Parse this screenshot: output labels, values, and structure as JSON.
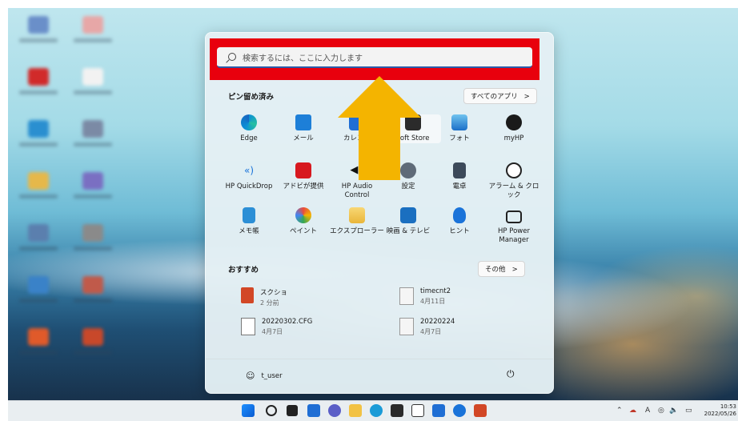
{
  "search": {
    "placeholder": "検索するには、ここに入力します"
  },
  "pinned": {
    "title": "ピン留め済み",
    "all_apps_label": "すべてのアプリ",
    "apps": [
      {
        "label": "Edge",
        "icon": "edge-icon"
      },
      {
        "label": "メール",
        "icon": "mail-icon"
      },
      {
        "label": "カレンダ",
        "icon": "calendar-icon"
      },
      {
        "label": "soft Store",
        "icon": "store-icon"
      },
      {
        "label": "フォト",
        "icon": "photos-icon"
      },
      {
        "label": "myHP",
        "icon": "myhp-icon"
      },
      {
        "label": "HP QuickDrop",
        "icon": "quickdrop-icon"
      },
      {
        "label": "アドビが提供",
        "icon": "adobe-icon"
      },
      {
        "label": "HP Audio Control",
        "icon": "audio-icon"
      },
      {
        "label": "設定",
        "icon": "gear-icon"
      },
      {
        "label": "電卓",
        "icon": "calculator-icon"
      },
      {
        "label": "アラーム & クロック",
        "icon": "alarm-clock-icon"
      },
      {
        "label": "メモ帳",
        "icon": "notepad-icon"
      },
      {
        "label": "ペイント",
        "icon": "paint-icon"
      },
      {
        "label": "エクスプローラー",
        "icon": "folder-icon"
      },
      {
        "label": "映画 & テレビ",
        "icon": "movies-icon"
      },
      {
        "label": "ヒント",
        "icon": "tips-icon"
      },
      {
        "label": "HP Power Manager",
        "icon": "power-manager-icon"
      }
    ]
  },
  "recommended": {
    "title": "おすすめ",
    "more_label": "その他",
    "items": [
      {
        "name": "スクショ",
        "time": "2 分前",
        "icon": "powerpoint-file-icon"
      },
      {
        "name": "timecnt2",
        "time": "4月11日",
        "icon": "text-file-icon"
      },
      {
        "name": "20220302.CFG",
        "time": "4月7日",
        "icon": "blank-file-icon"
      },
      {
        "name": "20220224",
        "time": "4月7日",
        "icon": "text-file-icon"
      }
    ]
  },
  "user": {
    "name": "t_user"
  },
  "clock": {
    "time": "10:53",
    "date": "2022/05/26"
  },
  "colors": {
    "highlight": "#e8000d",
    "arrow": "#f4b400",
    "accent": "#2b5aa8"
  }
}
